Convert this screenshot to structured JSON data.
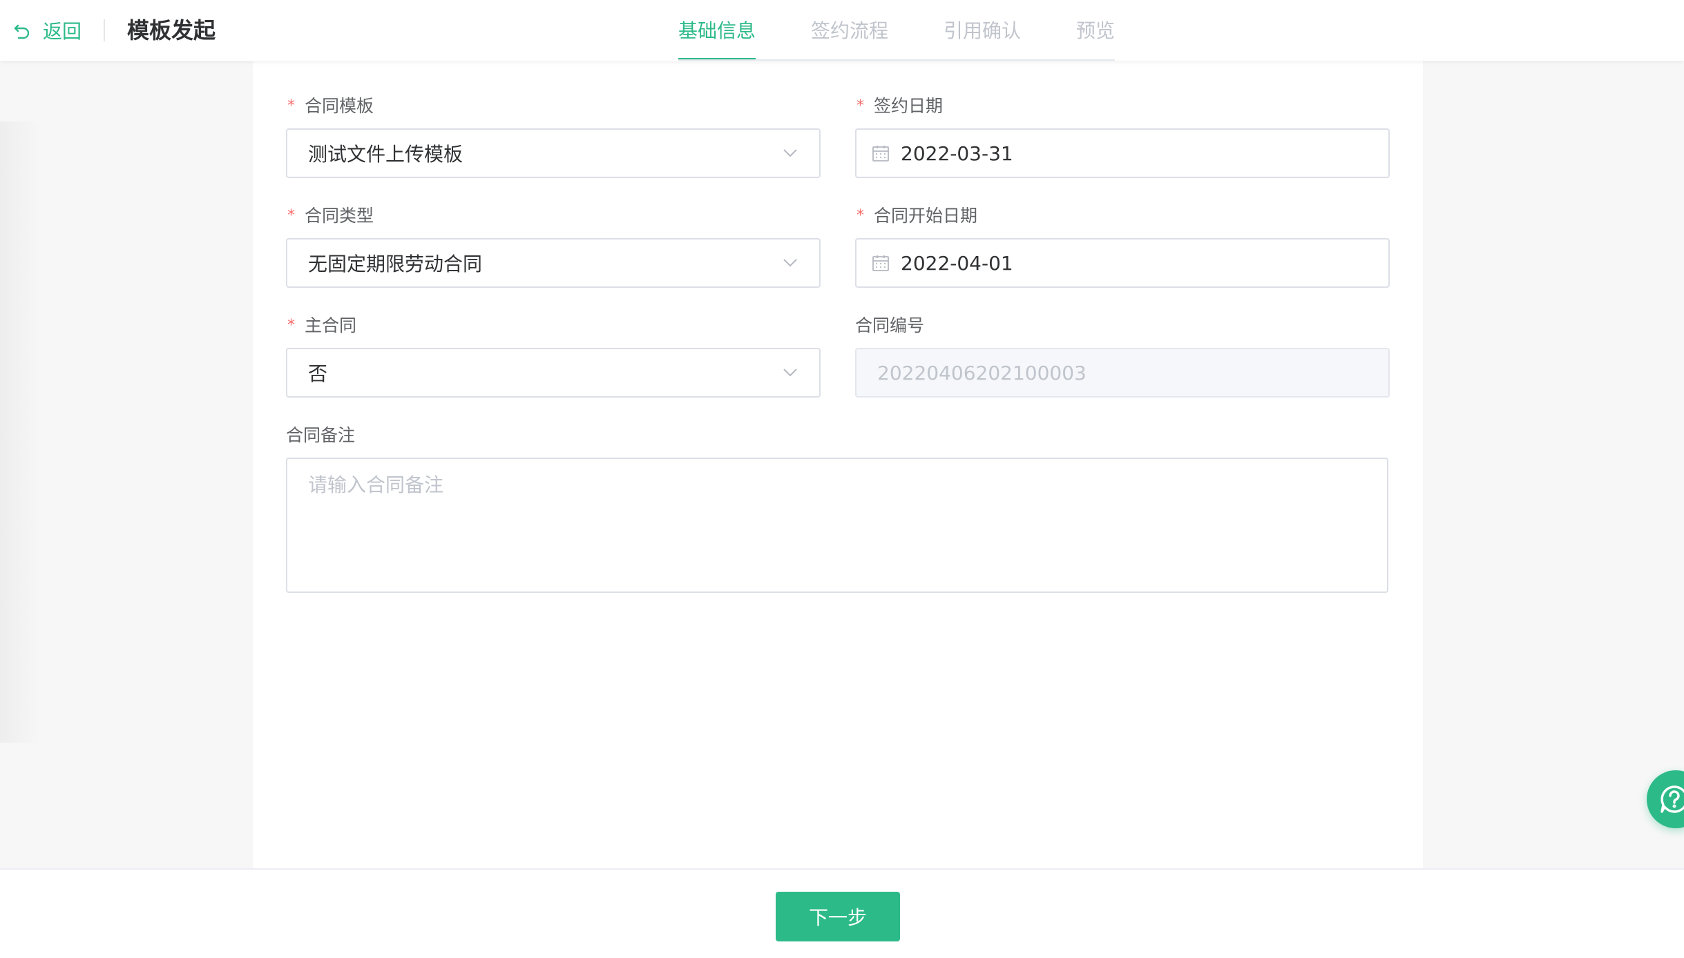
{
  "header": {
    "back_label": "返回",
    "title": "模板发起"
  },
  "tabs": [
    {
      "label": "基础信息",
      "active": true
    },
    {
      "label": "签约流程",
      "active": false
    },
    {
      "label": "引用确认",
      "active": false
    },
    {
      "label": "预览",
      "active": false
    }
  ],
  "form": {
    "template": {
      "label": "合同模板",
      "required": true,
      "value": "测试文件上传模板"
    },
    "sign_date": {
      "label": "签约日期",
      "required": true,
      "value": "2022-03-31"
    },
    "contract_type": {
      "label": "合同类型",
      "required": true,
      "value": "无固定期限劳动合同"
    },
    "start_date": {
      "label": "合同开始日期",
      "required": true,
      "value": "2022-04-01"
    },
    "main_contract": {
      "label": "主合同",
      "required": true,
      "value": "否"
    },
    "contract_no": {
      "label": "合同编号",
      "required": false,
      "value": "20220406202100003"
    },
    "remark": {
      "label": "合同备注",
      "required": false,
      "placeholder": "请输入合同备注",
      "value": ""
    }
  },
  "footer": {
    "next_label": "下一步"
  },
  "colors": {
    "accent": "#2dba89",
    "required": "#f56c6c",
    "border": "#dcdfe6"
  },
  "icons": {
    "back": "undo-arrow-icon",
    "dropdown": "chevron-down-icon",
    "date": "calendar-icon",
    "help": "help-question-icon"
  }
}
